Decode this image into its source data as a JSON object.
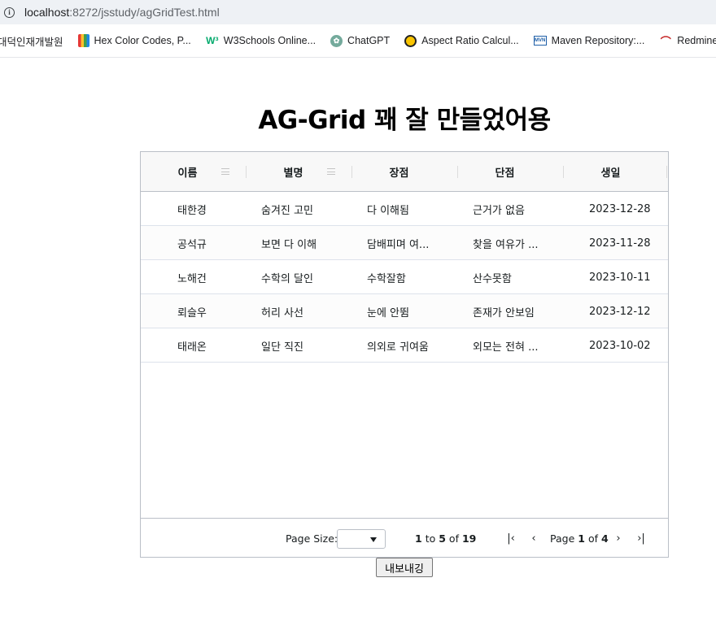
{
  "browser": {
    "url_host": "localhost",
    "url_path": ":8272/jsstudy/agGridTest.html",
    "bookmarks": [
      {
        "label": "대덕인재개발원",
        "icon": "none"
      },
      {
        "label": "Hex Color Codes, P...",
        "icon": "hex-color-icon"
      },
      {
        "label": "W3Schools Online...",
        "icon": "w3schools-icon"
      },
      {
        "label": "ChatGPT",
        "icon": "chatgpt-icon"
      },
      {
        "label": "Aspect Ratio Calcul...",
        "icon": "aspect-ratio-icon"
      },
      {
        "label": "Maven Repository:...",
        "icon": "maven-icon"
      },
      {
        "label": "Redmine",
        "icon": "redmine-icon"
      }
    ]
  },
  "page": {
    "title": "AG-Grid 꽤 잘 만들었어용",
    "export_label": "내보내깅"
  },
  "grid": {
    "columns": [
      "이름",
      "별명",
      "장점",
      "단점",
      "생일"
    ],
    "rows": [
      [
        "태한경",
        "숨겨진 고민",
        "다 이해됨",
        "근거가 없음",
        "2023-12-28"
      ],
      [
        "공석규",
        "보면 다 이해",
        "담배피며 여...",
        "찾을 여유가 ...",
        "2023-11-28"
      ],
      [
        "노해건",
        "수학의 달인",
        "수학잘함",
        "산수못함",
        "2023-10-11"
      ],
      [
        "뢰슬우",
        "허리 사선",
        "눈에 안뜀",
        "존재가 안보임",
        "2023-12-12"
      ],
      [
        "태래온",
        "일단 직진",
        "의외로 귀여움",
        "외모는 전혀 ...",
        "2023-10-02"
      ]
    ],
    "paging": {
      "page_size_label": "Page Size:",
      "page_size_value": "",
      "row_from": "1",
      "to_label": "to",
      "row_to": "5",
      "of_label": "of",
      "row_total": "19",
      "page_label": "Page",
      "page_current": "1",
      "page_of_label": "of",
      "page_total": "4",
      "first_glyph": "|‹",
      "prev_glyph": "‹",
      "next_glyph": "›",
      "last_glyph": "›|"
    }
  }
}
